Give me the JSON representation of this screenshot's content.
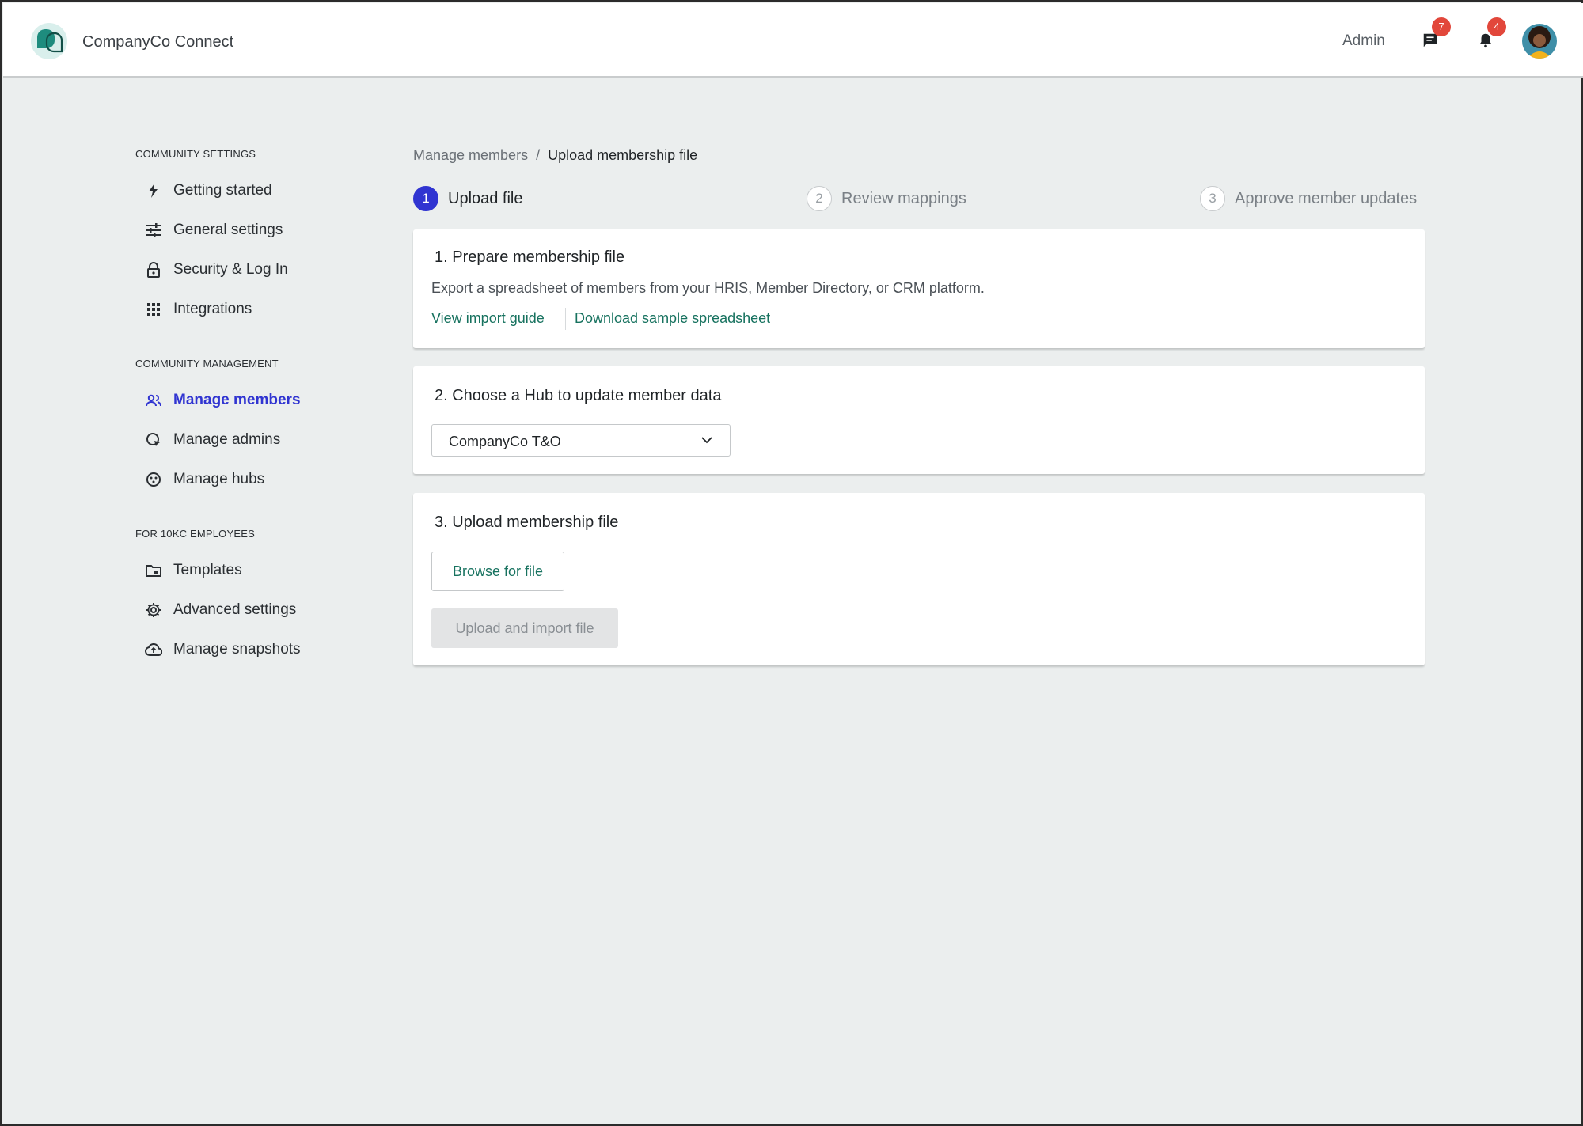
{
  "app": {
    "title": "CompanyCo Connect",
    "admin_label": "Admin",
    "messages_count": "7",
    "notifications_count": "4"
  },
  "colors": {
    "accent": "#3034d1",
    "link": "#17725f",
    "badge": "#e2473b",
    "logo": "#1e8c7e"
  },
  "sidebar": {
    "sections": [
      {
        "title": "COMMUNITY SETTINGS",
        "items": [
          {
            "label": "Getting started",
            "icon": "lightning-icon"
          },
          {
            "label": "General settings",
            "icon": "sliders-icon"
          },
          {
            "label": "Security & Log In",
            "icon": "lock-icon"
          },
          {
            "label": "Integrations",
            "icon": "grid-icon"
          }
        ]
      },
      {
        "title": "COMMUNITY MANAGEMENT",
        "items": [
          {
            "label": "Manage members",
            "icon": "people-icon",
            "active": true
          },
          {
            "label": "Manage admins",
            "icon": "admin-shield-icon"
          },
          {
            "label": "Manage hubs",
            "icon": "hub-icon"
          }
        ]
      },
      {
        "title": "FOR 10KC EMPLOYEES",
        "items": [
          {
            "label": "Templates",
            "icon": "folder-icon"
          },
          {
            "label": "Advanced settings",
            "icon": "gear-icon"
          },
          {
            "label": "Manage snapshots",
            "icon": "cloud-upload-icon"
          }
        ]
      }
    ]
  },
  "breadcrumb": {
    "parent": "Manage members",
    "separator": "/",
    "current": "Upload membership file"
  },
  "steps": [
    {
      "number": "1",
      "label": "Upload file",
      "active": true
    },
    {
      "number": "2",
      "label": "Review mappings",
      "active": false
    },
    {
      "number": "3",
      "label": "Approve member updates",
      "active": false
    }
  ],
  "cards": {
    "prepare": {
      "title": "1. Prepare membership file",
      "description": "Export a spreadsheet of members from your HRIS, Member Directory, or CRM platform.",
      "guide_link": "View import guide",
      "sample_link": "Download sample spreadsheet"
    },
    "hub": {
      "title": "2. Choose a Hub to update member data",
      "selected_hub": "CompanyCo T&O"
    },
    "upload": {
      "title": "3. Upload membership file",
      "browse_label": "Browse for file",
      "upload_label": "Upload and import file"
    }
  }
}
